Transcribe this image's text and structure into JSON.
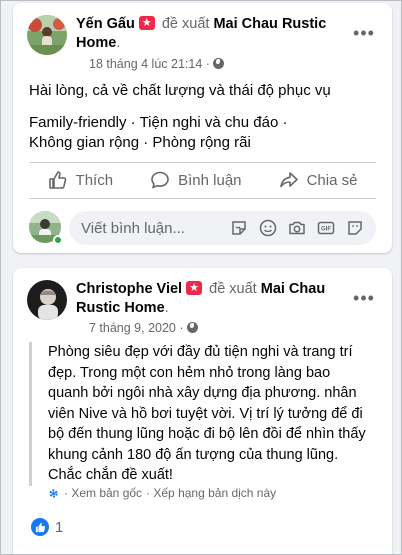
{
  "posts": [
    {
      "author": "Yến Gấu",
      "verb": "đề xuất",
      "page": "Mai Chau Rustic Home",
      "page_suffix": ".",
      "timestamp": "18 tháng 4 lúc 21:14 ·",
      "text": "Hài lòng, cả về chất lượng và thái độ phục vụ",
      "tags_line1": "Family-friendly · Tiện nghi và chu đáo ·",
      "tags_line2": "Không gian rộng · Phòng rộng rãi",
      "actions": {
        "like": "Thích",
        "comment": "Bình luận",
        "share": "Chia sẻ"
      },
      "comment_placeholder": "Viết bình luận..."
    },
    {
      "author": "Christophe Viel",
      "verb": "đề xuất",
      "page_line1": "Mai Chau",
      "page_line2": "Rustic Home",
      "page_suffix": ".",
      "timestamp": "7 tháng 9, 2020 ·",
      "text": "Phòng siêu đẹp với đầy đủ tiện nghi và trang trí đẹp. Trong một con hẻm nhỏ trong làng bao quanh bởi ngôi nhà xây dựng địa phương. nhân viên Nive và hồ bơi tuyệt vời. Vị trí lý tưởng để đi bộ đến thung lũng hoặc đi bộ lên đồi để nhìn thấy khung cảnh 180 độ ấn tượng của thung lũng. Chắc chắn đề xuất!",
      "see_original": "· Xem bản gốc",
      "rate_translation": "· Xếp hạng bản dịch này",
      "reaction_count": "1"
    }
  ],
  "icons": {
    "more": "more-horizontal-icon",
    "like": "thumbs-up-icon",
    "comment": "speech-bubble-icon",
    "share": "share-arrow-icon",
    "globe": "globe-icon",
    "sticker": "sticker-icon",
    "emoji": "emoji-icon",
    "camera": "camera-icon",
    "gif": "gif-icon",
    "sticker2": "sticker-smile-icon",
    "gear": "gear-icon"
  },
  "colors": {
    "recommend_badge": "#f02849",
    "like_blue": "#1877f2",
    "secondary_text": "#65676b",
    "online_green": "#31a24c"
  }
}
